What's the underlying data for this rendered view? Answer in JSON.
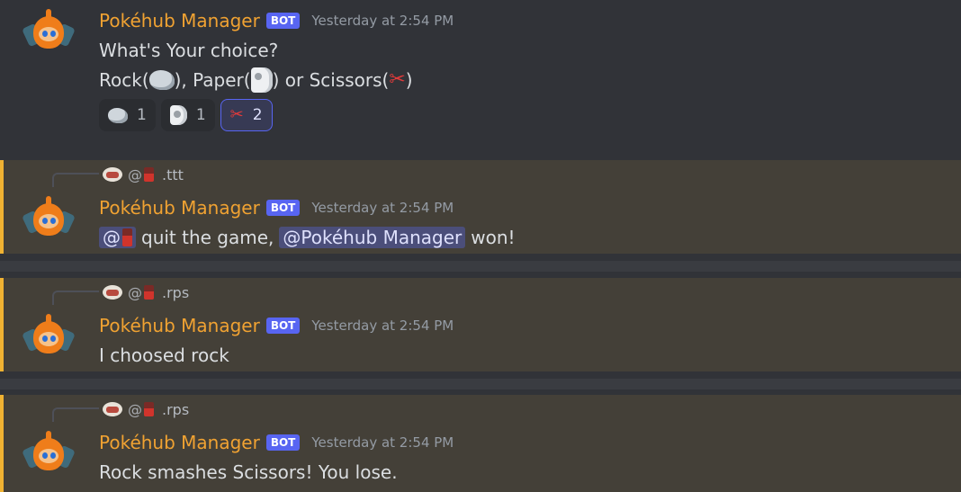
{
  "bot_name": "Pokéhub Manager",
  "bot_tag": "BOT",
  "timestamp": "Yesterday at 2:54 PM",
  "messages": [
    {
      "line1": "What's Your choice?",
      "line2_parts": [
        "Rock(",
        "), Paper(",
        ") or Scissors(",
        ")"
      ],
      "reactions": [
        {
          "emoji": "rock",
          "count": "1"
        },
        {
          "emoji": "paper",
          "count": "1"
        },
        {
          "emoji": "scissors",
          "count": "2"
        }
      ]
    },
    {
      "reply_command": ".ttt",
      "at": "@",
      "text_after_mention": "quit the game,",
      "bot_mention": "@Pokéhub Manager",
      "text_end": "won!"
    },
    {
      "reply_command": ".rps",
      "at": "@",
      "text": "I choosed rock"
    },
    {
      "reply_command": ".rps",
      "at": "@",
      "text": "Rock smashes Scissors! You lose."
    }
  ],
  "icons": {
    "rock": "rock-emoji",
    "paper": "toilet-paper-emoji",
    "scissors": "scissors-emoji"
  },
  "colors": {
    "bot_name": "#f0a232",
    "bot_tag": "#5865f2",
    "mention_bg": "#444038",
    "mention_border": "#f0b232",
    "background": "#313338"
  }
}
